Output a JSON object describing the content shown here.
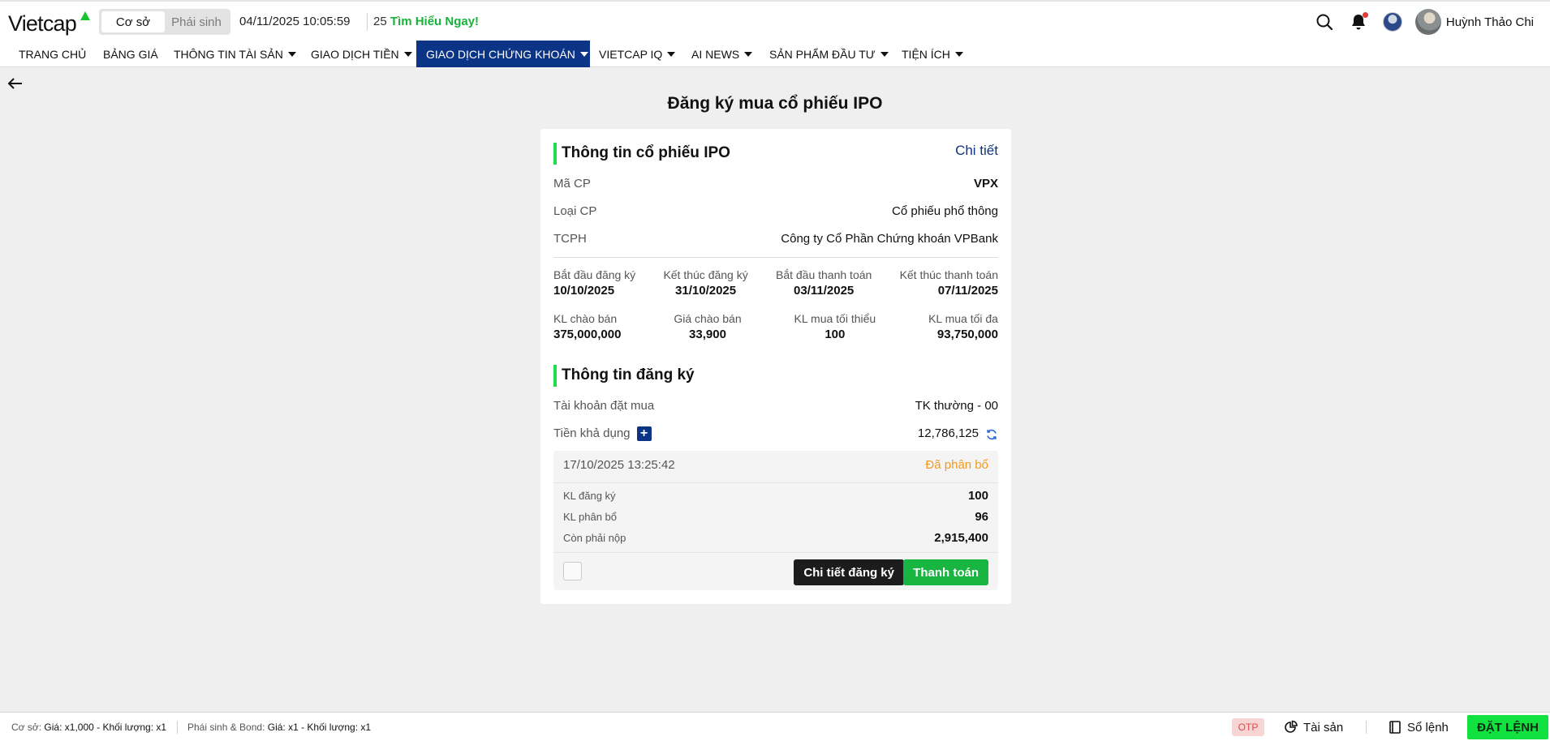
{
  "header": {
    "logo": "Vietcap",
    "market_tabs": [
      "Cơ sở",
      "Phái sinh"
    ],
    "active_market": "Cơ sở",
    "datetime": "04/11/2025 10:05:59",
    "ticker_prefix": "25",
    "ticker_text": "Tìm Hiểu Ngay!",
    "user_name": "Huỳnh Thảo Chi"
  },
  "nav": {
    "items": [
      {
        "label": "TRANG CHỦ",
        "dropdown": false
      },
      {
        "label": "BẢNG GIÁ",
        "dropdown": false
      },
      {
        "label": "THÔNG TIN TÀI SẢN",
        "dropdown": true
      },
      {
        "label": "GIAO DỊCH TIỀN",
        "dropdown": true
      },
      {
        "label": "GIAO DỊCH CHỨNG KHOÁN",
        "dropdown": true,
        "active": true
      },
      {
        "label": "VIETCAP IQ",
        "dropdown": true
      },
      {
        "label": "AI NEWS",
        "dropdown": true
      },
      {
        "label": "SẢN PHẨM ĐẦU TƯ",
        "dropdown": true
      },
      {
        "label": "TIỆN ÍCH",
        "dropdown": true
      }
    ]
  },
  "page": {
    "title": "Đăng ký mua cổ phiếu IPO"
  },
  "ipo_info": {
    "section_title": "Thông tin cổ phiếu IPO",
    "detail_link": "Chi tiết",
    "rows": [
      {
        "label": "Mã CP",
        "value": "VPX"
      },
      {
        "label": "Loại CP",
        "value": "Cổ phiếu phổ thông"
      },
      {
        "label": "TCPH",
        "value": "Công ty Cổ Phần Chứng khoán VPBank"
      }
    ],
    "dates": [
      {
        "label": "Bắt đầu đăng ký",
        "value": "10/10/2025"
      },
      {
        "label": "Kết thúc đăng ký",
        "value": "31/10/2025"
      },
      {
        "label": "Bắt đầu thanh toán",
        "value": "03/11/2025"
      },
      {
        "label": "Kết thúc thanh toán",
        "value": "07/11/2025"
      }
    ],
    "volumes": [
      {
        "label": "KL chào bán",
        "value": "375,000,000"
      },
      {
        "label": "Giá chào bán",
        "value": "33,900"
      },
      {
        "label": "KL mua tối thiểu",
        "value": "100"
      },
      {
        "label": "KL mua tối đa",
        "value": "93,750,000"
      }
    ]
  },
  "registration": {
    "section_title": "Thông tin đăng ký",
    "account_label": "Tài khoản đặt mua",
    "account_value": "TK thường - 00",
    "balance_label": "Tiền khả dụng",
    "balance_value": "12,786,125",
    "record": {
      "timestamp": "17/10/2025 13:25:42",
      "status": "Đã phân bổ",
      "rows": [
        {
          "label": "KL đăng ký",
          "value": "100"
        },
        {
          "label": "KL phân bổ",
          "value": "96"
        },
        {
          "label": "Còn phải nộp",
          "value": "2,915,400"
        }
      ],
      "detail_button": "Chi tiết đăng ký",
      "pay_button": "Thanh toán"
    }
  },
  "footer": {
    "spot_label": "Cơ sở:",
    "spot_value": "Giá: x1,000 - Khối lượng: x1",
    "deriv_label": "Phái sinh & Bond:",
    "deriv_value": "Giá: x1 - Khối lượng: x1",
    "otp": "OTP",
    "assets": "Tài sản",
    "orderbook": "Sổ lệnh",
    "place_order": "ĐẶT LỆNH"
  },
  "colors": {
    "brand_navy": "#0b3486",
    "accent_green": "#19b541",
    "status_orange": "#f39a1e",
    "section_bar": "#1ce04a"
  }
}
